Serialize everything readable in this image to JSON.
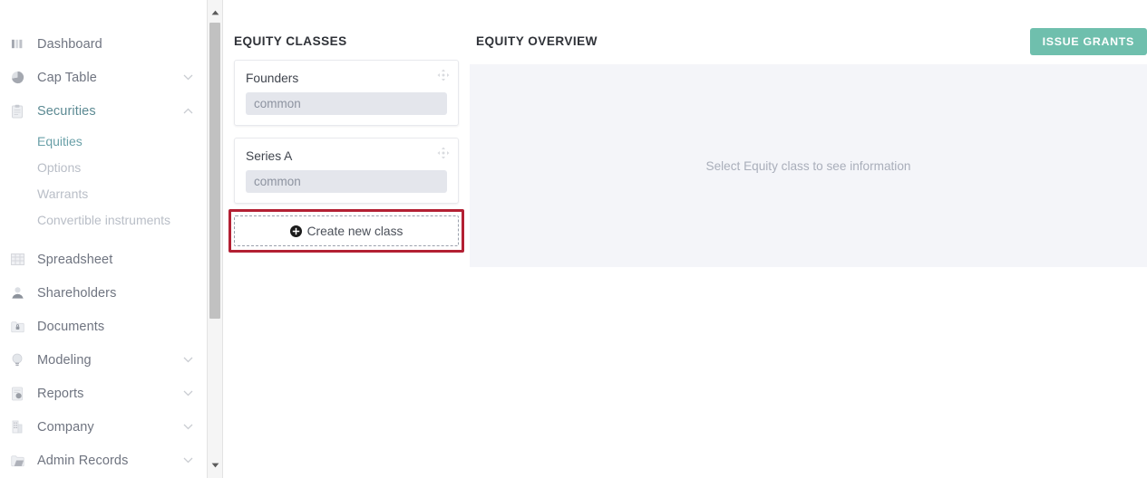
{
  "sidebar": {
    "items": [
      {
        "label": "Dashboard",
        "icon": "bar-chart-icon",
        "state": "normal",
        "expandable": false
      },
      {
        "label": "Cap Table",
        "icon": "pie-chart-icon",
        "state": "normal",
        "expandable": true,
        "chevron": "down"
      },
      {
        "label": "Securities",
        "icon": "clipboard-icon",
        "state": "active",
        "expandable": true,
        "chevron": "up"
      }
    ],
    "sub_items": [
      {
        "label": "Equities",
        "state": "active"
      },
      {
        "label": "Options",
        "state": "muted"
      },
      {
        "label": "Warrants",
        "state": "muted"
      },
      {
        "label": "Convertible instruments",
        "state": "muted"
      }
    ],
    "items_bottom": [
      {
        "label": "Spreadsheet",
        "icon": "grid-icon",
        "state": "normal",
        "expandable": false
      },
      {
        "label": "Shareholders",
        "icon": "person-icon",
        "state": "normal",
        "expandable": false
      },
      {
        "label": "Documents",
        "icon": "lock-folder-icon",
        "state": "normal",
        "expandable": false
      },
      {
        "label": "Modeling",
        "icon": "lightbulb-icon",
        "state": "normal",
        "expandable": true,
        "chevron": "down"
      },
      {
        "label": "Reports",
        "icon": "report-icon",
        "state": "normal",
        "expandable": true,
        "chevron": "down"
      },
      {
        "label": "Company",
        "icon": "building-icon",
        "state": "normal",
        "expandable": true,
        "chevron": "down"
      },
      {
        "label": "Admin Records",
        "icon": "folder-icon",
        "state": "normal",
        "expandable": true,
        "chevron": "down"
      }
    ]
  },
  "equity_classes": {
    "title": "EQUITY CLASSES",
    "cards": [
      {
        "name": "Founders",
        "type": "common",
        "drag_icon": "move-icon"
      },
      {
        "name": "Series A",
        "type": "common",
        "drag_icon": "move-icon"
      }
    ],
    "create_button": {
      "label": "Create new class",
      "icon": "plus-circle-icon",
      "highlighted": true,
      "highlight_color": "#b32033"
    }
  },
  "equity_overview": {
    "title": "EQUITY OVERVIEW",
    "empty_message": "Select Equity class to see information",
    "issue_grants_label": "ISSUE GRANTS",
    "accent_color": "#6fbfad",
    "panel_bg": "#f4f5f9"
  },
  "scrollbar": {
    "up_arrow": "triangle-up-icon",
    "down_arrow": "triangle-down-icon"
  }
}
